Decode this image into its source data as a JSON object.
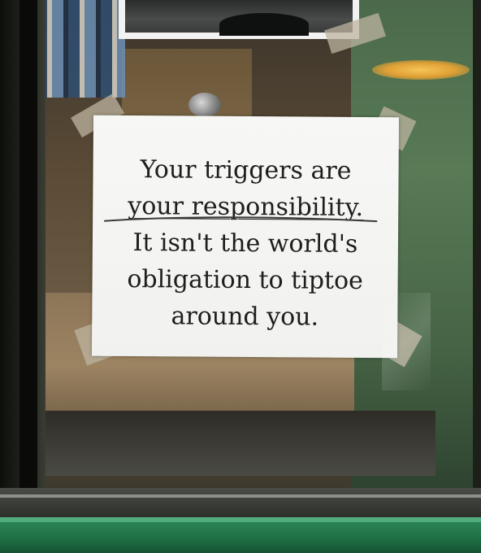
{
  "sign": {
    "lines": [
      "Your triggers are",
      "your responsibility.",
      "It isn't the world's",
      "obligation to tiptoe",
      "around you."
    ]
  }
}
